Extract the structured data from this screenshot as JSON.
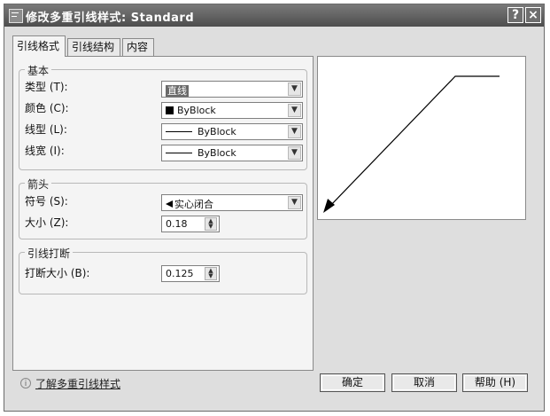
{
  "window": {
    "title": "修改多重引线样式: Standard",
    "help_glyph": "?",
    "close_glyph": "×"
  },
  "tabs": [
    {
      "label": "引线格式"
    },
    {
      "label": "引线结构"
    },
    {
      "label": "内容"
    }
  ],
  "basic": {
    "title": "基本",
    "type_label": "类型 (T):",
    "type_value": "直线",
    "color_label": "颜色 (C):",
    "color_value": "ByBlock",
    "color_swatch": "#000000",
    "linetype_label": "线型 (L):",
    "linetype_value": "ByBlock",
    "lineweight_label": "线宽 (I):",
    "lineweight_value": "ByBlock"
  },
  "arrow": {
    "title": "箭头",
    "symbol_label": "符号 (S):",
    "symbol_value": "实心闭合",
    "size_label": "大小 (Z):",
    "size_value": "0.18"
  },
  "landing": {
    "title": "引线打断",
    "break_size_label": "打断大小 (B):",
    "break_size_value": "0.125"
  },
  "footer": {
    "info_glyph": "i",
    "link": "了解多重引线样式",
    "ok": "确定",
    "cancel": "取消",
    "help": "帮助 (H)"
  }
}
